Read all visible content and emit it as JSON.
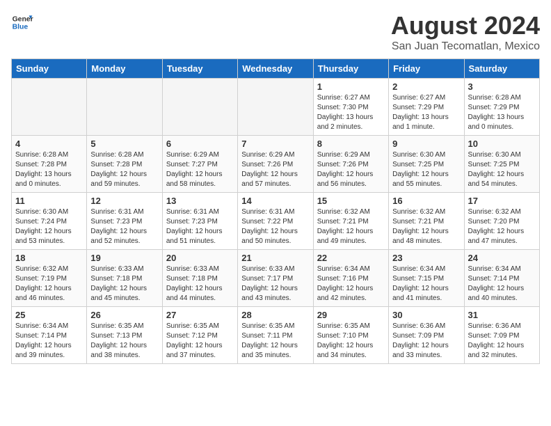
{
  "header": {
    "logo_general": "General",
    "logo_blue": "Blue",
    "month_year": "August 2024",
    "location": "San Juan Tecomatlan, Mexico"
  },
  "days_of_week": [
    "Sunday",
    "Monday",
    "Tuesday",
    "Wednesday",
    "Thursday",
    "Friday",
    "Saturday"
  ],
  "weeks": [
    [
      {
        "day": "",
        "empty": true
      },
      {
        "day": "",
        "empty": true
      },
      {
        "day": "",
        "empty": true
      },
      {
        "day": "",
        "empty": true
      },
      {
        "day": "1",
        "sunrise": "6:27 AM",
        "sunset": "7:30 PM",
        "daylight": "13 hours and 2 minutes."
      },
      {
        "day": "2",
        "sunrise": "6:27 AM",
        "sunset": "7:29 PM",
        "daylight": "13 hours and 1 minute."
      },
      {
        "day": "3",
        "sunrise": "6:28 AM",
        "sunset": "7:29 PM",
        "daylight": "13 hours and 0 minutes."
      }
    ],
    [
      {
        "day": "4",
        "sunrise": "6:28 AM",
        "sunset": "7:28 PM",
        "daylight": "13 hours and 0 minutes."
      },
      {
        "day": "5",
        "sunrise": "6:28 AM",
        "sunset": "7:28 PM",
        "daylight": "12 hours and 59 minutes."
      },
      {
        "day": "6",
        "sunrise": "6:29 AM",
        "sunset": "7:27 PM",
        "daylight": "12 hours and 58 minutes."
      },
      {
        "day": "7",
        "sunrise": "6:29 AM",
        "sunset": "7:26 PM",
        "daylight": "12 hours and 57 minutes."
      },
      {
        "day": "8",
        "sunrise": "6:29 AM",
        "sunset": "7:26 PM",
        "daylight": "12 hours and 56 minutes."
      },
      {
        "day": "9",
        "sunrise": "6:30 AM",
        "sunset": "7:25 PM",
        "daylight": "12 hours and 55 minutes."
      },
      {
        "day": "10",
        "sunrise": "6:30 AM",
        "sunset": "7:25 PM",
        "daylight": "12 hours and 54 minutes."
      }
    ],
    [
      {
        "day": "11",
        "sunrise": "6:30 AM",
        "sunset": "7:24 PM",
        "daylight": "12 hours and 53 minutes."
      },
      {
        "day": "12",
        "sunrise": "6:31 AM",
        "sunset": "7:23 PM",
        "daylight": "12 hours and 52 minutes."
      },
      {
        "day": "13",
        "sunrise": "6:31 AM",
        "sunset": "7:23 PM",
        "daylight": "12 hours and 51 minutes."
      },
      {
        "day": "14",
        "sunrise": "6:31 AM",
        "sunset": "7:22 PM",
        "daylight": "12 hours and 50 minutes."
      },
      {
        "day": "15",
        "sunrise": "6:32 AM",
        "sunset": "7:21 PM",
        "daylight": "12 hours and 49 minutes."
      },
      {
        "day": "16",
        "sunrise": "6:32 AM",
        "sunset": "7:21 PM",
        "daylight": "12 hours and 48 minutes."
      },
      {
        "day": "17",
        "sunrise": "6:32 AM",
        "sunset": "7:20 PM",
        "daylight": "12 hours and 47 minutes."
      }
    ],
    [
      {
        "day": "18",
        "sunrise": "6:32 AM",
        "sunset": "7:19 PM",
        "daylight": "12 hours and 46 minutes."
      },
      {
        "day": "19",
        "sunrise": "6:33 AM",
        "sunset": "7:18 PM",
        "daylight": "12 hours and 45 minutes."
      },
      {
        "day": "20",
        "sunrise": "6:33 AM",
        "sunset": "7:18 PM",
        "daylight": "12 hours and 44 minutes."
      },
      {
        "day": "21",
        "sunrise": "6:33 AM",
        "sunset": "7:17 PM",
        "daylight": "12 hours and 43 minutes."
      },
      {
        "day": "22",
        "sunrise": "6:34 AM",
        "sunset": "7:16 PM",
        "daylight": "12 hours and 42 minutes."
      },
      {
        "day": "23",
        "sunrise": "6:34 AM",
        "sunset": "7:15 PM",
        "daylight": "12 hours and 41 minutes."
      },
      {
        "day": "24",
        "sunrise": "6:34 AM",
        "sunset": "7:14 PM",
        "daylight": "12 hours and 40 minutes."
      }
    ],
    [
      {
        "day": "25",
        "sunrise": "6:34 AM",
        "sunset": "7:14 PM",
        "daylight": "12 hours and 39 minutes."
      },
      {
        "day": "26",
        "sunrise": "6:35 AM",
        "sunset": "7:13 PM",
        "daylight": "12 hours and 38 minutes."
      },
      {
        "day": "27",
        "sunrise": "6:35 AM",
        "sunset": "7:12 PM",
        "daylight": "12 hours and 37 minutes."
      },
      {
        "day": "28",
        "sunrise": "6:35 AM",
        "sunset": "7:11 PM",
        "daylight": "12 hours and 35 minutes."
      },
      {
        "day": "29",
        "sunrise": "6:35 AM",
        "sunset": "7:10 PM",
        "daylight": "12 hours and 34 minutes."
      },
      {
        "day": "30",
        "sunrise": "6:36 AM",
        "sunset": "7:09 PM",
        "daylight": "12 hours and 33 minutes."
      },
      {
        "day": "31",
        "sunrise": "6:36 AM",
        "sunset": "7:09 PM",
        "daylight": "12 hours and 32 minutes."
      }
    ]
  ]
}
